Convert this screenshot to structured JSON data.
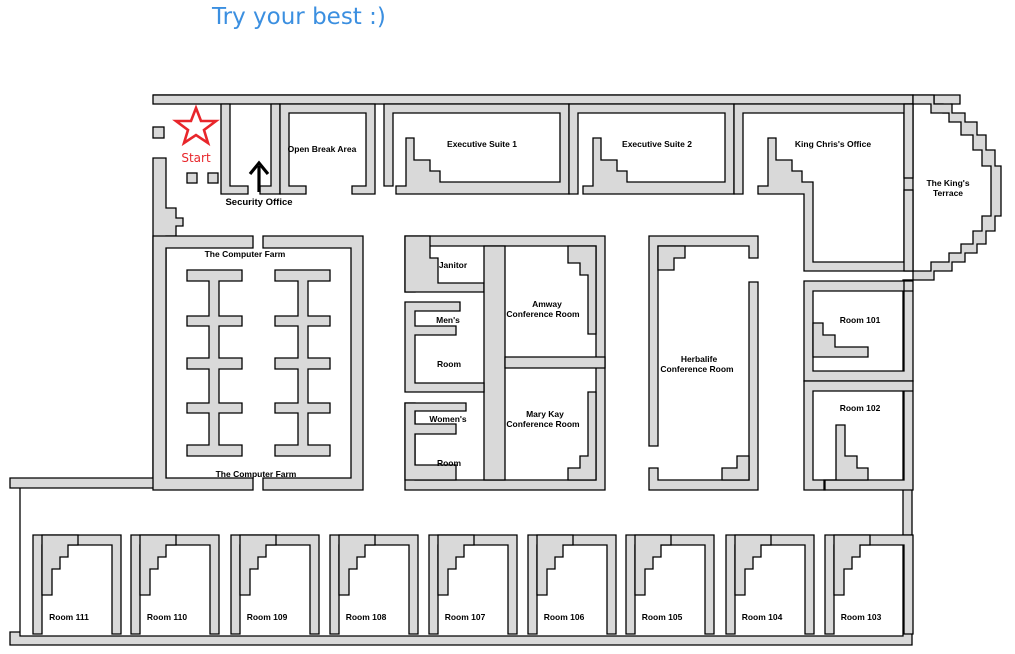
{
  "header": {
    "title": "Try your best :)"
  },
  "start": {
    "label": "Start"
  },
  "colors": {
    "accent": "#3b8fe0",
    "start_marker": "#e8262b",
    "wall_fill": "#d9d9d9"
  },
  "labels": {
    "security_office": "Security Office",
    "open_break_area": "Open Break Area",
    "executive_suite_1": "Executive Suite 1",
    "executive_suite_2": "Executive Suite 2",
    "king_chris_office": "King Chris's Office",
    "kings_terrace_1": "The King's",
    "kings_terrace_2": "Terrace",
    "computer_farm_top": "The Computer Farm",
    "computer_farm_bottom": "The Computer Farm",
    "janitor": "Janitor",
    "mens_1": "Men's",
    "mens_2": "Room",
    "womens_1": "Women's",
    "womens_2": "Room",
    "amway_1": "Amway",
    "amway_2": "Conference Room",
    "marykay_1": "Mary Kay",
    "marykay_2": "Conference Room",
    "herbalife_1": "Herbalife",
    "herbalife_2": "Conference Room",
    "room_101": "Room 101",
    "room_102": "Room 102",
    "room_103": "Room 103",
    "room_104": "Room 104",
    "room_105": "Room 105",
    "room_106": "Room 106",
    "room_107": "Room 107",
    "room_108": "Room 108",
    "room_109": "Room 109",
    "room_110": "Room 110",
    "room_111": "Room 111"
  }
}
